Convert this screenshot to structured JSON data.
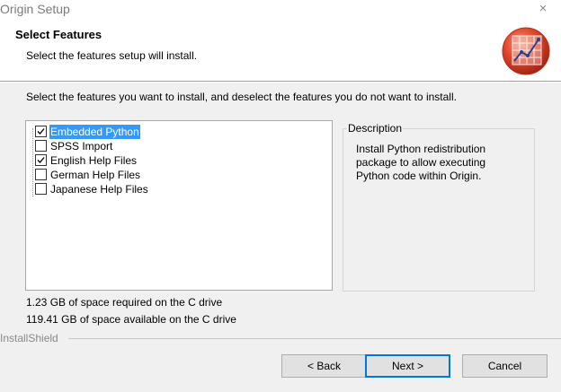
{
  "window": {
    "title": "Origin Setup",
    "close_glyph": "×"
  },
  "header": {
    "title": "Select Features",
    "subtitle": "Select the features setup will install.",
    "logo_icon": "origin-graph-icon"
  },
  "instruction": "Select the features you want to install, and deselect the features you do not want to install.",
  "features": [
    {
      "label": "Embedded Python",
      "checked": true,
      "selected": true
    },
    {
      "label": "SPSS Import",
      "checked": false,
      "selected": false
    },
    {
      "label": "English Help Files",
      "checked": true,
      "selected": false
    },
    {
      "label": "German Help Files",
      "checked": false,
      "selected": false
    },
    {
      "label": "Japanese Help Files",
      "checked": false,
      "selected": false
    }
  ],
  "description": {
    "title": "Description",
    "text": "Install Python redistribution package to allow executing Python code within Origin."
  },
  "space": {
    "required": "1.23 GB of space required on the C drive",
    "available": "119.41 GB of space available on the C drive"
  },
  "footer": {
    "brand": "InstallShield",
    "back_label": "< Back",
    "next_label": "Next >",
    "cancel_label": "Cancel"
  },
  "colors": {
    "selection": "#3399ff",
    "default_button_border": "#0078d7",
    "logo_red": "#d9432e"
  }
}
